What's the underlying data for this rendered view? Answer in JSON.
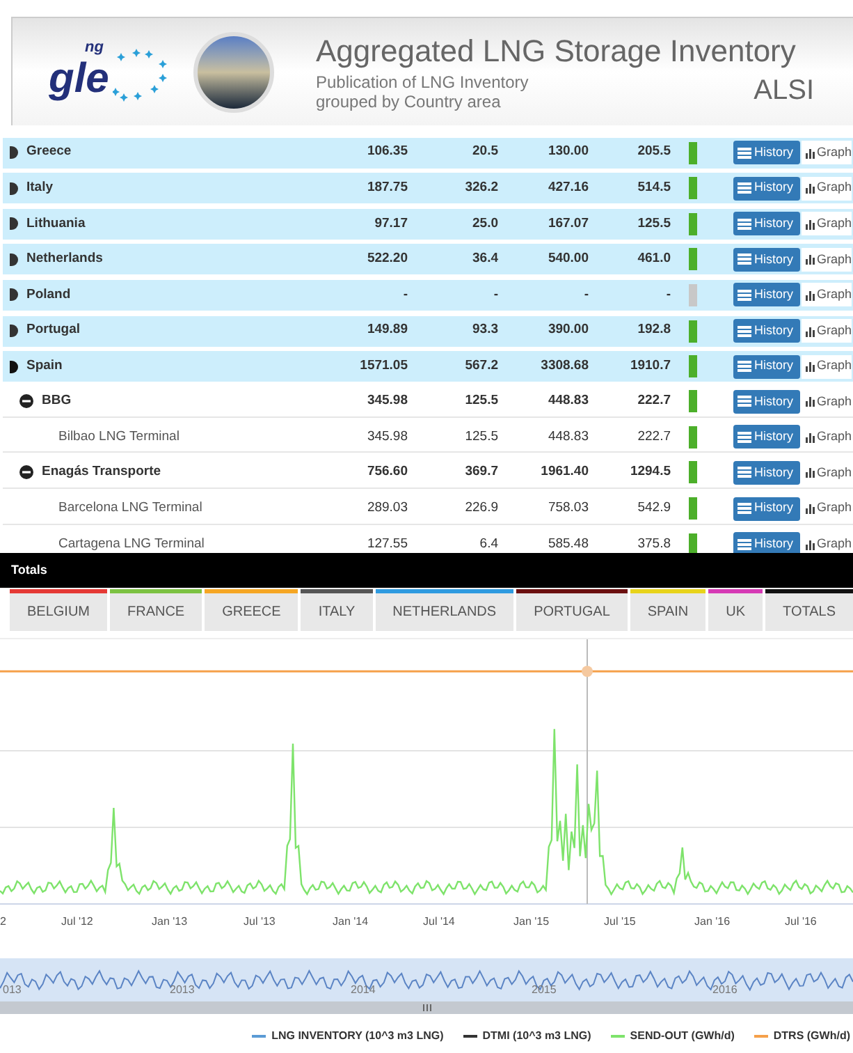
{
  "header": {
    "logo_text": "gle",
    "logo_sup": "ng",
    "title": "Aggregated LNG Storage Inventory",
    "subtitle_lines": [
      "Publication of LNG Inventory",
      "grouped by Country area"
    ],
    "code": "ALSI"
  },
  "table": {
    "rows": [
      {
        "kind": "country",
        "name": "Greece",
        "expanded": false,
        "values": [
          "106.35",
          "20.5",
          "130.00",
          "205.5"
        ],
        "color": "#4caf2a",
        "history": "History",
        "graph": "Graph"
      },
      {
        "kind": "country",
        "name": "Italy",
        "expanded": false,
        "values": [
          "187.75",
          "326.2",
          "427.16",
          "514.5"
        ],
        "color": "#4caf2a",
        "history": "History",
        "graph": "Graph"
      },
      {
        "kind": "country",
        "name": "Lithuania",
        "expanded": false,
        "values": [
          "97.17",
          "25.0",
          "167.07",
          "125.5"
        ],
        "color": "#4caf2a",
        "history": "History",
        "graph": "Graph"
      },
      {
        "kind": "country",
        "name": "Netherlands",
        "expanded": false,
        "values": [
          "522.20",
          "36.4",
          "540.00",
          "461.0"
        ],
        "color": "#4caf2a",
        "history": "History",
        "graph": "Graph"
      },
      {
        "kind": "country",
        "name": "Poland",
        "expanded": false,
        "values": [
          "-",
          "-",
          "-",
          "-"
        ],
        "color": "#c8c8c8",
        "history": "History",
        "graph": "Graph"
      },
      {
        "kind": "country",
        "name": "Portugal",
        "expanded": false,
        "values": [
          "149.89",
          "93.3",
          "390.00",
          "192.8"
        ],
        "color": "#4caf2a",
        "history": "History",
        "graph": "Graph"
      },
      {
        "kind": "country",
        "name": "Spain",
        "expanded": true,
        "values": [
          "1571.05",
          "567.2",
          "3308.68",
          "1910.7"
        ],
        "color": "#4caf2a",
        "history": "History",
        "graph": "Graph",
        "children": [
          {
            "kind": "operator",
            "name": "BBG",
            "expanded": true,
            "values": [
              "345.98",
              "125.5",
              "448.83",
              "222.7"
            ],
            "color": "#4caf2a",
            "history": "History",
            "graph": "Graph",
            "children": [
              {
                "kind": "terminal",
                "name": "Bilbao LNG Terminal",
                "values": [
                  "345.98",
                  "125.5",
                  "448.83",
                  "222.7"
                ],
                "color": "#4caf2a",
                "history": "History",
                "graph": "Graph"
              }
            ]
          },
          {
            "kind": "operator",
            "name": "Enagás Transporte",
            "expanded": true,
            "values": [
              "756.60",
              "369.7",
              "1961.40",
              "1294.5"
            ],
            "color": "#4caf2a",
            "history": "History",
            "graph": "Graph",
            "children": [
              {
                "kind": "terminal",
                "name": "Barcelona LNG Terminal",
                "values": [
                  "289.03",
                  "226.9",
                  "758.03",
                  "542.9"
                ],
                "color": "#4caf2a",
                "history": "History",
                "graph": "Graph"
              },
              {
                "kind": "terminal",
                "name": "Cartagena LNG Terminal",
                "values": [
                  "127.55",
                  "6.4",
                  "585.48",
                  "375.8"
                ],
                "color": "#4caf2a",
                "history": "History",
                "graph": "Graph"
              }
            ]
          }
        ]
      }
    ]
  },
  "totals_bar": {
    "title": "Totals"
  },
  "country_tabs": [
    {
      "label": "BELGIUM",
      "color": "#e53935"
    },
    {
      "label": "FRANCE",
      "color": "#7cc242"
    },
    {
      "label": "GREECE",
      "color": "#f5a623"
    },
    {
      "label": "ITALY",
      "color": "#555555"
    },
    {
      "label": "NETHERLANDS",
      "color": "#2f9be0"
    },
    {
      "label": "PORTUGAL",
      "color": "#6b0f0f"
    },
    {
      "label": "SPAIN",
      "color": "#e8d31a"
    },
    {
      "label": "UK",
      "color": "#d63ab5"
    },
    {
      "label": "TOTALS",
      "color": "#111111"
    }
  ],
  "chart": {
    "x_labels": [
      "2",
      "Jul '12",
      "Jan '13",
      "Jul '13",
      "Jan '14",
      "Jul '14",
      "Jan '15",
      "Jul '15",
      "Jan '16",
      "Jul '16"
    ],
    "navigator_labels": [
      "013",
      "2013",
      "2014",
      "2015",
      "2016"
    ],
    "legend": [
      {
        "label": "LNG INVENTORY (10^3 m3 LNG)",
        "color": "#5b9bd5"
      },
      {
        "label": "DTMI (10^3 m3 LNG)",
        "color": "#333333"
      },
      {
        "label": "SEND-OUT (GWh/d)",
        "color": "#7ee36b"
      },
      {
        "label": "DTRS (GWh/d)",
        "color": "#f5a04a"
      }
    ]
  }
}
